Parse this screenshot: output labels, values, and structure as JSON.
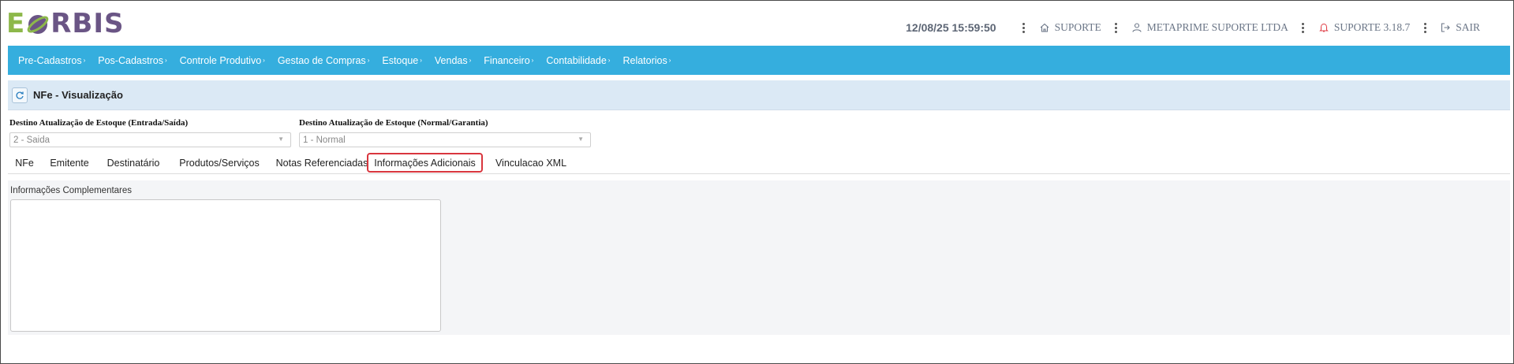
{
  "header": {
    "logo": {
      "e": "E",
      "rest": "RBIS"
    },
    "datetime": "12/08/25 15:59:50",
    "items": [
      {
        "label": "SUPORTE",
        "icon": "home-icon"
      },
      {
        "label": "METAPRIME SUPORTE LTDA",
        "icon": "user-icon"
      },
      {
        "label": "SUPORTE 3.18.7",
        "icon": "bell-icon"
      },
      {
        "label": "SAIR",
        "icon": "logout-icon"
      }
    ]
  },
  "nav": {
    "items": [
      "Pre-Cadastros",
      "Pos-Cadastros",
      "Controle Produtivo",
      "Gestao de Compras",
      "Estoque",
      "Vendas",
      "Financeiro",
      "Contabilidade",
      "Relatorios"
    ]
  },
  "page": {
    "title": "NFe - Visualização"
  },
  "fields": {
    "entrada_saida": {
      "label": "Destino Atualização de Estoque (Entrada/Saída)",
      "value": "2 - Saida"
    },
    "normal_garantia": {
      "label": "Destino Atualização de Estoque (Normal/Garantia)",
      "value": "1 - Normal"
    }
  },
  "tabs": [
    {
      "label": "NFe"
    },
    {
      "label": "Emitente"
    },
    {
      "label": "Destinatário"
    },
    {
      "label": "Produtos/Serviços"
    },
    {
      "label": "Notas Referenciadas"
    },
    {
      "label": "Informações Adicionais",
      "active": true
    },
    {
      "label": "Vinculacao XML"
    }
  ],
  "content": {
    "label": "Informações Complementares",
    "value": ""
  },
  "colors": {
    "navbar": "#35aede",
    "logo_green": "#8db84a",
    "logo_purple": "#6a5585",
    "active_tab_border": "#d9363e"
  }
}
